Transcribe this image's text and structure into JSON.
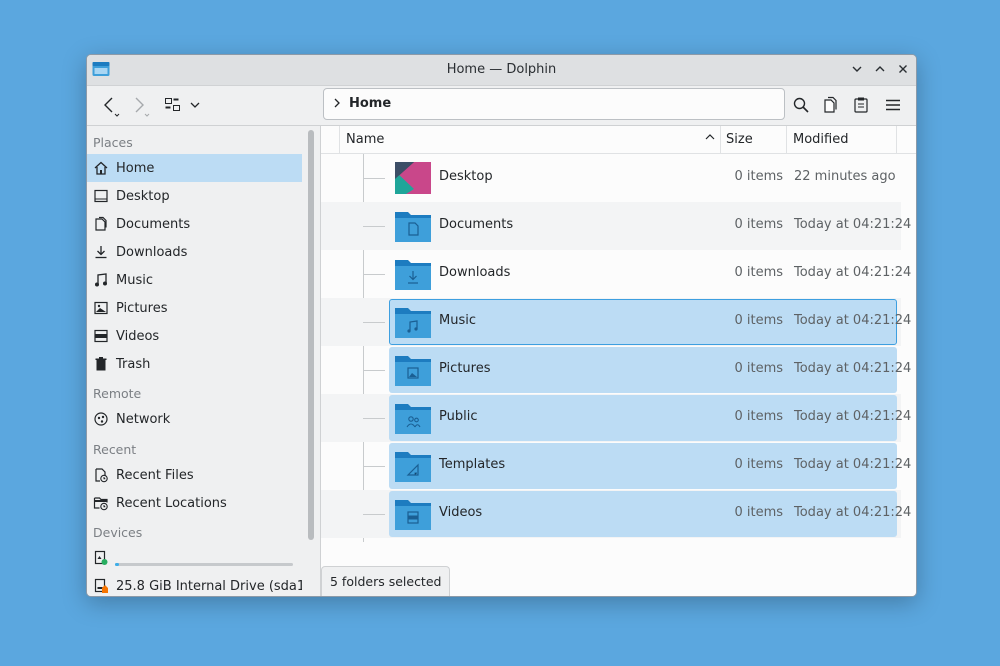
{
  "window": {
    "title": "Home — Dolphin"
  },
  "toolbar": {
    "breadcrumb": "Home"
  },
  "sidebar": {
    "sections": {
      "places": "Places",
      "remote": "Remote",
      "recent": "Recent",
      "devices": "Devices"
    },
    "places": [
      {
        "label": "Home",
        "icon": "home-icon"
      },
      {
        "label": "Desktop",
        "icon": "desktop-icon"
      },
      {
        "label": "Documents",
        "icon": "documents-icon"
      },
      {
        "label": "Downloads",
        "icon": "downloads-icon"
      },
      {
        "label": "Music",
        "icon": "music-icon"
      },
      {
        "label": "Pictures",
        "icon": "pictures-icon"
      },
      {
        "label": "Videos",
        "icon": "videos-icon"
      },
      {
        "label": "Trash",
        "icon": "trash-icon"
      }
    ],
    "remote": [
      {
        "label": "Network",
        "icon": "network-icon"
      }
    ],
    "recent": [
      {
        "label": "Recent Files",
        "icon": "recent-files-icon"
      },
      {
        "label": "Recent Locations",
        "icon": "recent-locations-icon"
      }
    ],
    "devices": [
      {
        "label": "",
        "icon": "removable-drive-icon",
        "capacity_fraction": 0.02
      },
      {
        "label": "25.8 GiB Internal Drive (sda1)",
        "icon": "internal-drive-icon"
      }
    ]
  },
  "columns": {
    "name": "Name",
    "size": "Size",
    "modified": "Modified"
  },
  "files": [
    {
      "name": "Desktop",
      "size": "0 items",
      "modified": "22 minutes ago",
      "icon": "desktop-folder-icon",
      "selected": false
    },
    {
      "name": "Documents",
      "size": "0 items",
      "modified": "Today at 04:21:24",
      "icon": "documents-folder-icon",
      "selected": false
    },
    {
      "name": "Downloads",
      "size": "0 items",
      "modified": "Today at 04:21:24",
      "icon": "downloads-folder-icon",
      "selected": false
    },
    {
      "name": "Music",
      "size": "0 items",
      "modified": "Today at 04:21:24",
      "icon": "music-folder-icon",
      "selected": true
    },
    {
      "name": "Pictures",
      "size": "0 items",
      "modified": "Today at 04:21:24",
      "icon": "pictures-folder-icon",
      "selected": true
    },
    {
      "name": "Public",
      "size": "0 items",
      "modified": "Today at 04:21:24",
      "icon": "public-folder-icon",
      "selected": true
    },
    {
      "name": "Templates",
      "size": "0 items",
      "modified": "Today at 04:21:24",
      "icon": "templates-folder-icon",
      "selected": true
    },
    {
      "name": "Videos",
      "size": "0 items",
      "modified": "Today at 04:21:24",
      "icon": "videos-folder-icon",
      "selected": true
    }
  ],
  "status": {
    "text": "5 folders selected"
  },
  "colors": {
    "selection": "#bcdcf4",
    "accent": "#3daee9",
    "folder": "#3e9fda",
    "background": "#5ba7df"
  }
}
